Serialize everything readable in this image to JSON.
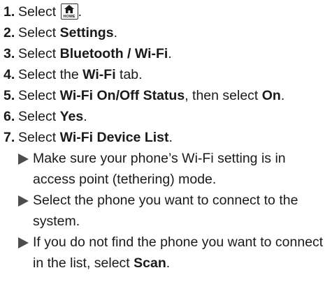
{
  "steps": [
    {
      "num": "1.",
      "prefix": "Select ",
      "icon": "home-icon",
      "icon_label": "HOME",
      "suffix": "."
    },
    {
      "num": "2.",
      "prefix": "Select ",
      "bold": "Settings",
      "suffix": "."
    },
    {
      "num": "3.",
      "prefix": "Select ",
      "bold": "Bluetooth / Wi-Fi",
      "suffix": "."
    },
    {
      "num": "4.",
      "prefix": "Select the ",
      "bold": "Wi-Fi",
      "suffix": " tab."
    },
    {
      "num": "5.",
      "prefix": "Select ",
      "bold": "Wi-Fi On/Off Status",
      "middle": ", then select ",
      "bold2": "On",
      "suffix": "."
    },
    {
      "num": "6.",
      "prefix": "Select ",
      "bold": "Yes",
      "suffix": "."
    },
    {
      "num": "7.",
      "prefix": "Select ",
      "bold": "Wi-Fi Device List",
      "suffix": "."
    }
  ],
  "notes": [
    {
      "text": "Make sure your phone’s Wi-Fi setting is in access point (tethering) mode."
    },
    {
      "text": "Select the phone you want to connect to the system."
    },
    {
      "text": "If you do not find the phone you want to connect in the list, select ",
      "bold": "Scan",
      "suffix": "."
    }
  ],
  "colors": {
    "text": "#1a1a1a",
    "bullet": "#4d4d4d"
  }
}
